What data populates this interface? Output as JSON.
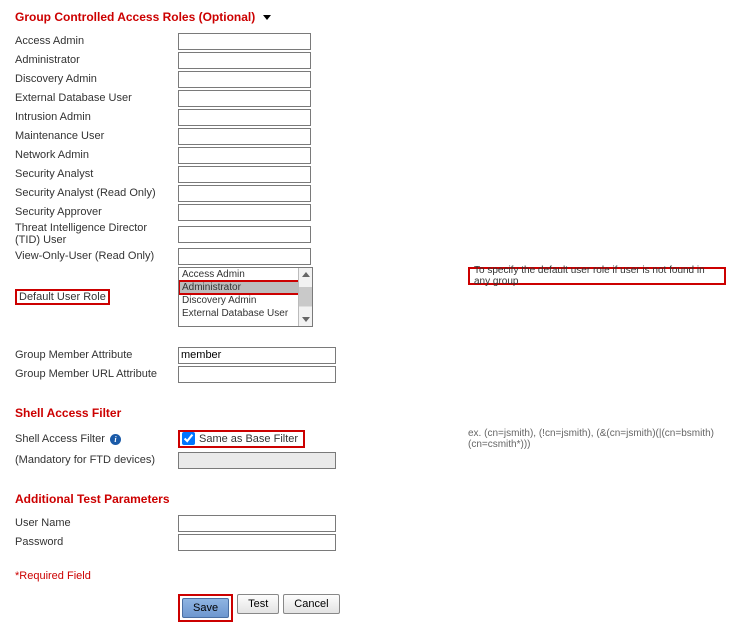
{
  "sections": {
    "group_roles_header": "Group Controlled Access Roles (Optional)",
    "shell_filter_header": "Shell Access Filter",
    "additional_test_header": "Additional Test Parameters"
  },
  "roles": {
    "access_admin": "Access Admin",
    "administrator": "Administrator",
    "discovery_admin": "Discovery Admin",
    "external_db_user": "External Database User",
    "intrusion_admin": "Intrusion Admin",
    "maintenance_user": "Maintenance User",
    "network_admin": "Network Admin",
    "security_analyst": "Security Analyst",
    "security_analyst_ro": "Security Analyst (Read Only)",
    "security_approver": "Security Approver",
    "tid_user": "Threat Intelligence Director (TID) User",
    "view_only_ro": "View-Only-User (Read Only)"
  },
  "default_role": {
    "label": "Default User Role",
    "options": {
      "0": "Access Admin",
      "1": "Administrator",
      "2": "Discovery Admin",
      "3": "External Database User"
    },
    "selected_index": 1,
    "note": "To specify the default user role if user is not found in any group"
  },
  "group_member": {
    "attr_label": "Group Member Attribute",
    "attr_value": "member",
    "url_attr_label": "Group Member URL Attribute",
    "url_attr_value": ""
  },
  "shell": {
    "filter_label": "Shell Access Filter",
    "mandatory_label": "(Mandatory for FTD devices)",
    "same_as_base_label": "Same as Base Filter",
    "example": "ex. (cn=jsmith), (!cn=jsmith), (&(cn=jsmith)(|(cn=bsmith)(cn=csmith*)))"
  },
  "test": {
    "user_label": "User Name",
    "password_label": "Password"
  },
  "footer": {
    "required": "*Required Field",
    "save": "Save",
    "test": "Test",
    "cancel": "Cancel"
  }
}
